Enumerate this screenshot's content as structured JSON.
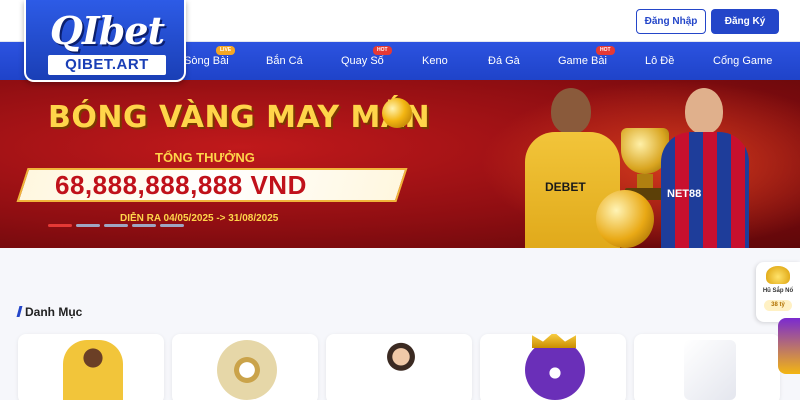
{
  "header": {
    "logo": {
      "name": "QIbet",
      "domain": "QIBET.ART"
    },
    "login_label": "Đăng Nhập",
    "register_label": "Đăng Ký"
  },
  "nav": {
    "items": [
      {
        "label": "Sòng Bài",
        "badge": "LIVE"
      },
      {
        "label": "Bắn Cá",
        "badge": ""
      },
      {
        "label": "Quay Số",
        "badge": "HOT"
      },
      {
        "label": "Keno",
        "badge": ""
      },
      {
        "label": "Đá Gà",
        "badge": ""
      },
      {
        "label": "Game Bài",
        "badge": "HOT"
      },
      {
        "label": "Lô Đề",
        "badge": ""
      },
      {
        "label": "Cổng Game",
        "badge": ""
      }
    ]
  },
  "banner": {
    "title": "BÓNG VÀNG MAY MẮN",
    "subtitle": "TỔNG THƯỞNG",
    "prize": "68,888,888,888 VND",
    "dates": "DIỄN RA 04/05/2025 -> 31/08/2025",
    "player1_sponsor": "DEBET",
    "player2_sponsor": "NET88",
    "slide_count": 5,
    "active_slide": 1
  },
  "content": {
    "section_title": "Danh Mục",
    "categories": [
      {
        "icon": "football-player-icon"
      },
      {
        "icon": "lottery-cage-icon"
      },
      {
        "icon": "casino-dealer-icon"
      },
      {
        "icon": "ball-8-crown-icon"
      },
      {
        "icon": "playing-cards-icon"
      }
    ]
  },
  "jackpot": {
    "title": "Hũ Sắp Nổ",
    "amount": "38 tỷ"
  },
  "colors": {
    "primary": "#2446c9",
    "banner_red": "#a3141a",
    "gold": "#ffd54a",
    "prize_red": "#c0111a"
  }
}
